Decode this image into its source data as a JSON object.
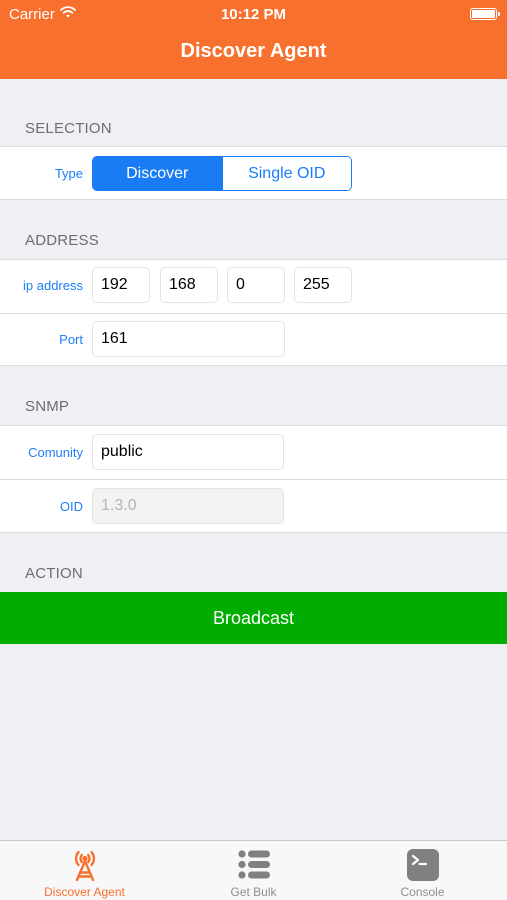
{
  "status_bar": {
    "carrier": "Carrier",
    "time": "10:12 PM"
  },
  "nav": {
    "title": "Discover Agent"
  },
  "selection": {
    "header": "SELECTION",
    "type_label": "Type",
    "segments": [
      "Discover",
      "Single OID"
    ],
    "selected": "Discover"
  },
  "address": {
    "header": "ADDRESS",
    "ip_label": "ip address",
    "ip_octets": [
      "192",
      "168",
      "0",
      "255"
    ],
    "port_label": "Port",
    "port_value": "161"
  },
  "snmp": {
    "header": "SNMP",
    "community_label": "Comunity",
    "community_value": "public",
    "oid_label": "OID",
    "oid_placeholder": "1.3.0"
  },
  "action": {
    "header": "ACTION",
    "button_label": "Broadcast"
  },
  "colors": {
    "accent": "#f7702d",
    "tint": "#1a7cf5",
    "button": "#00ad00"
  },
  "tabs": [
    {
      "label": "Discover Agent",
      "icon": "antenna-icon",
      "active": true
    },
    {
      "label": "Get Bulk",
      "icon": "list-icon",
      "active": false
    },
    {
      "label": "Console",
      "icon": "terminal-icon",
      "active": false
    }
  ]
}
